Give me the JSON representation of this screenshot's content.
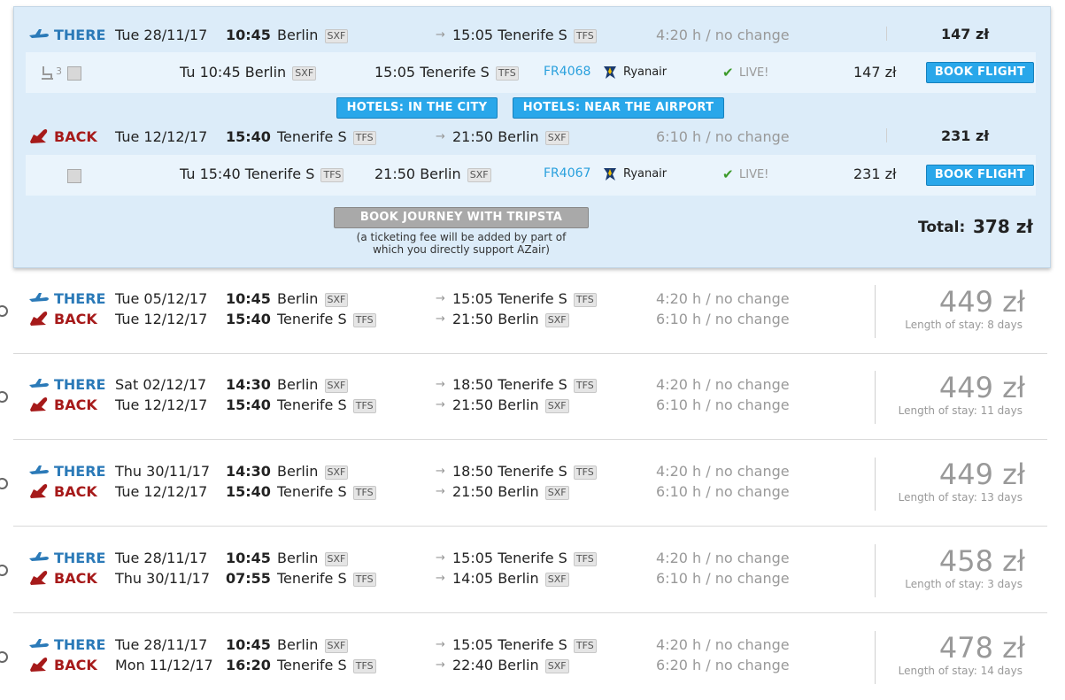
{
  "selected": {
    "there": {
      "label": "THERE",
      "date": "Tue 28/11/17",
      "time": "10:45",
      "from": "Berlin",
      "from_code": "SXF",
      "arr_time": "15:05",
      "to": "Tenerife S",
      "to_code": "TFS",
      "duration": "4:20 h / no change",
      "price": "147 zł"
    },
    "there_detail": {
      "seats": "3",
      "dep": "Tu 10:45 Berlin",
      "dep_code": "SXF",
      "arr": "15:05 Tenerife S",
      "arr_code": "TFS",
      "flight": "FR4068",
      "airline": "Ryanair",
      "live": "LIVE!",
      "price": "147 zł",
      "book": "BOOK FLIGHT"
    },
    "hotels_city": "HOTELS: IN THE CITY",
    "hotels_airport": "HOTELS: NEAR THE AIRPORT",
    "back": {
      "label": "BACK",
      "date": "Tue 12/12/17",
      "time": "15:40",
      "from": "Tenerife S",
      "from_code": "TFS",
      "arr_time": "21:50",
      "to": "Berlin",
      "to_code": "SXF",
      "duration": "6:10 h / no change",
      "price": "231 zł"
    },
    "back_detail": {
      "dep": "Tu 15:40 Tenerife S",
      "dep_code": "TFS",
      "arr": "21:50 Berlin",
      "arr_code": "SXF",
      "flight": "FR4067",
      "airline": "Ryanair",
      "live": "LIVE!",
      "price": "231 zł",
      "book": "BOOK FLIGHT"
    },
    "book_journey": "BOOK JOURNEY WITH TRIPSTA",
    "fee_note_1": "(a ticketing fee will be added by part of",
    "fee_note_2": "which you directly support AZair)",
    "total_label": "Total:",
    "total_value": "378 zł"
  },
  "results": [
    {
      "there": {
        "label": "THERE",
        "date": "Tue 05/12/17",
        "time": "10:45",
        "from": "Berlin",
        "from_code": "SXF",
        "arr_time": "15:05",
        "to": "Tenerife S",
        "to_code": "TFS",
        "duration": "4:20 h / no change"
      },
      "back": {
        "label": "BACK",
        "date": "Tue 12/12/17",
        "time": "15:40",
        "from": "Tenerife S",
        "from_code": "TFS",
        "arr_time": "21:50",
        "to": "Berlin",
        "to_code": "SXF",
        "duration": "6:10 h / no change"
      },
      "price": "449 zł",
      "stay": "Length of stay: 8 days"
    },
    {
      "there": {
        "label": "THERE",
        "date": "Sat 02/12/17",
        "time": "14:30",
        "from": "Berlin",
        "from_code": "SXF",
        "arr_time": "18:50",
        "to": "Tenerife S",
        "to_code": "TFS",
        "duration": "4:20 h / no change"
      },
      "back": {
        "label": "BACK",
        "date": "Tue 12/12/17",
        "time": "15:40",
        "from": "Tenerife S",
        "from_code": "TFS",
        "arr_time": "21:50",
        "to": "Berlin",
        "to_code": "SXF",
        "duration": "6:10 h / no change"
      },
      "price": "449 zł",
      "stay": "Length of stay: 11 days"
    },
    {
      "there": {
        "label": "THERE",
        "date": "Thu 30/11/17",
        "time": "14:30",
        "from": "Berlin",
        "from_code": "SXF",
        "arr_time": "18:50",
        "to": "Tenerife S",
        "to_code": "TFS",
        "duration": "4:20 h / no change"
      },
      "back": {
        "label": "BACK",
        "date": "Tue 12/12/17",
        "time": "15:40",
        "from": "Tenerife S",
        "from_code": "TFS",
        "arr_time": "21:50",
        "to": "Berlin",
        "to_code": "SXF",
        "duration": "6:10 h / no change"
      },
      "price": "449 zł",
      "stay": "Length of stay: 13 days"
    },
    {
      "there": {
        "label": "THERE",
        "date": "Tue 28/11/17",
        "time": "10:45",
        "from": "Berlin",
        "from_code": "SXF",
        "arr_time": "15:05",
        "to": "Tenerife S",
        "to_code": "TFS",
        "duration": "4:20 h / no change"
      },
      "back": {
        "label": "BACK",
        "date": "Thu 30/11/17",
        "time": "07:55",
        "from": "Tenerife S",
        "from_code": "TFS",
        "arr_time": "14:05",
        "to": "Berlin",
        "to_code": "SXF",
        "duration": "6:10 h / no change"
      },
      "price": "458 zł",
      "stay": "Length of stay: 3 days"
    },
    {
      "there": {
        "label": "THERE",
        "date": "Tue 28/11/17",
        "time": "10:45",
        "from": "Berlin",
        "from_code": "SXF",
        "arr_time": "15:05",
        "to": "Tenerife S",
        "to_code": "TFS",
        "duration": "4:20 h / no change"
      },
      "back": {
        "label": "BACK",
        "date": "Mon 11/12/17",
        "time": "16:20",
        "from": "Tenerife S",
        "from_code": "TFS",
        "arr_time": "22:40",
        "to": "Berlin",
        "to_code": "SXF",
        "duration": "6:20 h / no change"
      },
      "price": "478 zł",
      "stay": "Length of stay: 14 days"
    }
  ],
  "colors": {
    "there": "#2b7ab8",
    "back": "#a61a1a",
    "button": "#29a7ea",
    "panel": "#dcecf9"
  }
}
